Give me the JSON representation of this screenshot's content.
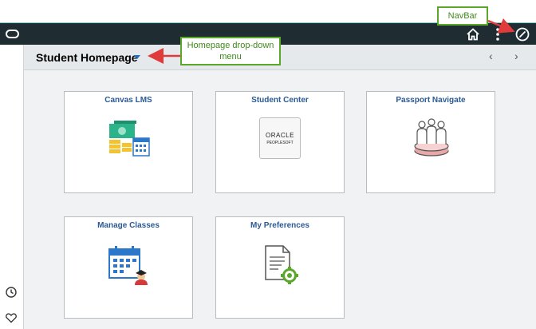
{
  "page": {
    "title": "Student Homepage"
  },
  "tiles": [
    {
      "title": "Canvas LMS"
    },
    {
      "title": "Student Center",
      "logo_line1": "ORACLE",
      "logo_line2": "PEOPLESOFT"
    },
    {
      "title": "Passport Navigate"
    },
    {
      "title": "Manage Classes"
    },
    {
      "title": "My Preferences"
    }
  ],
  "callouts": {
    "navbar": "NavBar",
    "homepage_menu": "Homepage drop-down menu"
  },
  "nav": {
    "home_icon": "home-icon",
    "actions_icon": "kebab-menu-icon",
    "navbar_icon": "compass-icon"
  },
  "pager": {
    "prev": "‹",
    "next": "›"
  },
  "colors": {
    "navbar": "#1f2d33",
    "tile_title": "#2b5a95",
    "callout_border": "#5aa72a",
    "callout_arrow": "#e03a3a",
    "caret": "#1d6fc9"
  }
}
